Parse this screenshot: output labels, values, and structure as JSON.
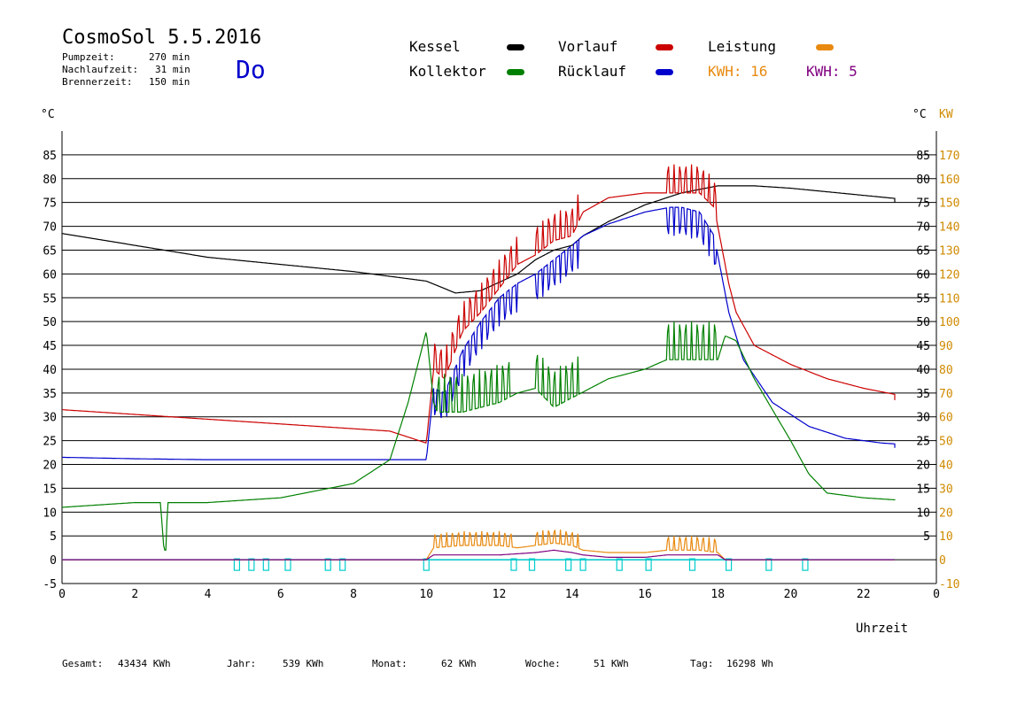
{
  "header": {
    "title": "CosmoSol 5.5.2016",
    "day": "Do",
    "stats": [
      {
        "label": "Pumpzeit:",
        "value": "270 min"
      },
      {
        "label": "Nachlaufzeit:",
        "value": "31 min"
      },
      {
        "label": "Brennerzeit:",
        "value": "150 min"
      }
    ]
  },
  "legend": {
    "kessel": "Kessel",
    "kollektor": "Kollektor",
    "vorlauf": "Vorlauf",
    "ruecklauf": "Rücklauf",
    "leistung": "Leistung",
    "kwh1": "KWH: 16",
    "kwh2": "KWH: 5"
  },
  "colors": {
    "kessel": "#000000",
    "kollektor": "#008000",
    "vorlauf": "#cc0000",
    "ruecklauf": "#0000cc",
    "leistung": "#e88a10",
    "kwh2": "#800080",
    "pump": "#00cccc",
    "kw_axis": "#d08a00"
  },
  "footer": [
    {
      "label": "Gesamt:",
      "value": "43434 KWh"
    },
    {
      "label": "Jahr:",
      "value": "539 KWh"
    },
    {
      "label": "Monat:",
      "value": "62 KWh"
    },
    {
      "label": "Woche:",
      "value": "51 KWh"
    },
    {
      "label": "Tag:",
      "value": "16298 Wh"
    }
  ],
  "chart_data": {
    "type": "line",
    "xlabel": "Uhrzeit",
    "ylabel_left": "°C",
    "ylabel_right_1": "°C",
    "ylabel_right_2": "KW",
    "xlim": [
      0,
      24
    ],
    "ylim": [
      -5,
      90
    ],
    "x_ticks": [
      "0",
      "2",
      "4",
      "6",
      "8",
      "10",
      "12",
      "14",
      "16",
      "18",
      "20",
      "22",
      "0"
    ],
    "y_ticks_left": [
      "-5",
      "0",
      "5",
      "10",
      "15",
      "20",
      "25",
      "30",
      "35",
      "40",
      "45",
      "50",
      "55",
      "60",
      "65",
      "70",
      "75",
      "80",
      "85"
    ],
    "y_ticks_right_celsius": [
      "5",
      "10",
      "15",
      "20",
      "25",
      "30",
      "35",
      "40",
      "45",
      "50",
      "55",
      "60",
      "65",
      "70",
      "75",
      "80",
      "85"
    ],
    "y_ticks_right_kw": [
      "-10",
      "0",
      "10",
      "20",
      "30",
      "40",
      "50",
      "60",
      "70",
      "80",
      "90",
      "100",
      "110",
      "120",
      "130",
      "140",
      "150",
      "160",
      "170"
    ],
    "grid": true,
    "series": [
      {
        "name": "Kessel",
        "key": "kessel",
        "x": [
          0,
          2,
          4,
          6,
          8,
          10,
          10.8,
          11.5,
          12.5,
          13,
          13.5,
          14,
          14.3,
          15,
          16,
          17,
          18,
          19,
          20,
          22,
          24
        ],
        "y": [
          68.5,
          66,
          63.5,
          62,
          60.5,
          58.5,
          56,
          56.5,
          60,
          63,
          65,
          66,
          68,
          71,
          74.5,
          77,
          78.5,
          78.5,
          78,
          76.5,
          75
        ]
      },
      {
        "name": "Vorlauf",
        "key": "vorlauf",
        "x": [
          0,
          2,
          4,
          6,
          8,
          9,
          10,
          10.2,
          10.5,
          11,
          11.5,
          12,
          12.5,
          13,
          13.5,
          14,
          14.3,
          15,
          16,
          16.7,
          17,
          17.5,
          17.9,
          18.3,
          18.5,
          19,
          20,
          21,
          22,
          23,
          24
        ],
        "y": [
          31.5,
          30.5,
          29.5,
          28.5,
          27.5,
          27,
          24.5,
          40,
          38,
          48,
          52,
          57,
          62,
          64,
          67,
          68,
          73,
          76,
          77,
          77,
          77,
          77,
          74,
          58,
          52,
          45,
          41,
          38,
          36,
          34.5,
          33.5
        ]
      },
      {
        "name": "Rücklauf",
        "key": "ruecklauf",
        "x": [
          0,
          2,
          4,
          6,
          8,
          9,
          10,
          10.2,
          10.5,
          11,
          11.5,
          12,
          12.5,
          13,
          13.5,
          14,
          14.3,
          15,
          16,
          16.7,
          17,
          17.5,
          17.9,
          18.3,
          18.7,
          19.5,
          20.5,
          21.5,
          22.5,
          23.5,
          24
        ],
        "y": [
          21.5,
          21.2,
          21,
          21,
          21,
          21,
          21,
          36,
          35,
          44,
          50,
          55,
          58,
          60,
          63,
          66,
          68,
          70.5,
          73,
          74,
          74,
          73,
          68,
          52,
          42,
          33,
          28,
          25.5,
          24.5,
          24,
          23.5
        ]
      },
      {
        "name": "Kollektor",
        "key": "kollektor",
        "x": [
          0,
          2,
          2.7,
          2.8,
          2.85,
          2.9,
          3,
          4,
          6,
          8,
          9,
          9.5,
          10,
          10.2,
          10.3,
          11,
          12,
          12.5,
          13,
          13.5,
          14,
          14.5,
          15,
          16,
          16.6,
          17,
          17.5,
          18,
          18.2,
          18.5,
          19,
          20,
          20.5,
          21,
          22,
          23,
          24
        ],
        "y": [
          11,
          12,
          12,
          2,
          2,
          12,
          12,
          12,
          13,
          16,
          21,
          33,
          48,
          33,
          31,
          31,
          33,
          35,
          36,
          32,
          34,
          36,
          38,
          40,
          42,
          42,
          42,
          42,
          47,
          46,
          38,
          25,
          18,
          14,
          13,
          12.5,
          12.5
        ]
      },
      {
        "name": "Leistung",
        "key": "leistung",
        "x": [
          0,
          10,
          10.2,
          11,
          12,
          12.5,
          13,
          13.5,
          14,
          14.3,
          15,
          16,
          16.6,
          17,
          17.5,
          18,
          18.2,
          24
        ],
        "y": [
          0,
          0,
          2.5,
          3,
          3,
          2.5,
          3,
          3.5,
          3,
          2,
          1.5,
          1.5,
          2,
          2,
          2,
          1.5,
          0,
          0
        ]
      },
      {
        "name": "KWH: 5",
        "key": "kwh2",
        "x": [
          0,
          10,
          10.2,
          12,
          13,
          13.5,
          14,
          14.3,
          15,
          16,
          16.6,
          18,
          18.2,
          24
        ],
        "y": [
          0,
          0,
          1,
          1,
          1.5,
          2,
          1.5,
          1,
          0.5,
          0.5,
          1,
          1,
          0,
          0
        ]
      }
    ],
    "spikes": [
      {
        "key": "vorlauf",
        "ranges": [
          [
            10.2,
            12.5
          ],
          [
            13,
            14.3
          ],
          [
            16.6,
            18
          ]
        ],
        "amplitude": 6
      },
      {
        "key": "ruecklauf",
        "ranges": [
          [
            10.2,
            12.5
          ],
          [
            13,
            14.3
          ],
          [
            16.6,
            18
          ]
        ],
        "amplitude": -6
      },
      {
        "key": "kollektor",
        "ranges": [
          [
            10.3,
            12.4
          ],
          [
            13,
            14.3
          ],
          [
            16.6,
            18
          ]
        ],
        "amplitude": 8
      },
      {
        "key": "leistung",
        "ranges": [
          [
            10.2,
            12.4
          ],
          [
            13,
            14.3
          ],
          [
            16.6,
            18
          ]
        ],
        "amplitude": 3
      }
    ],
    "pump_pulses_x": [
      4.8,
      5.2,
      5.6,
      6.2,
      7.3,
      7.7,
      10.0,
      12.4,
      12.9,
      13.9,
      14.3,
      15.3,
      16.1,
      17.3,
      18.3,
      19.4,
      20.4
    ]
  }
}
